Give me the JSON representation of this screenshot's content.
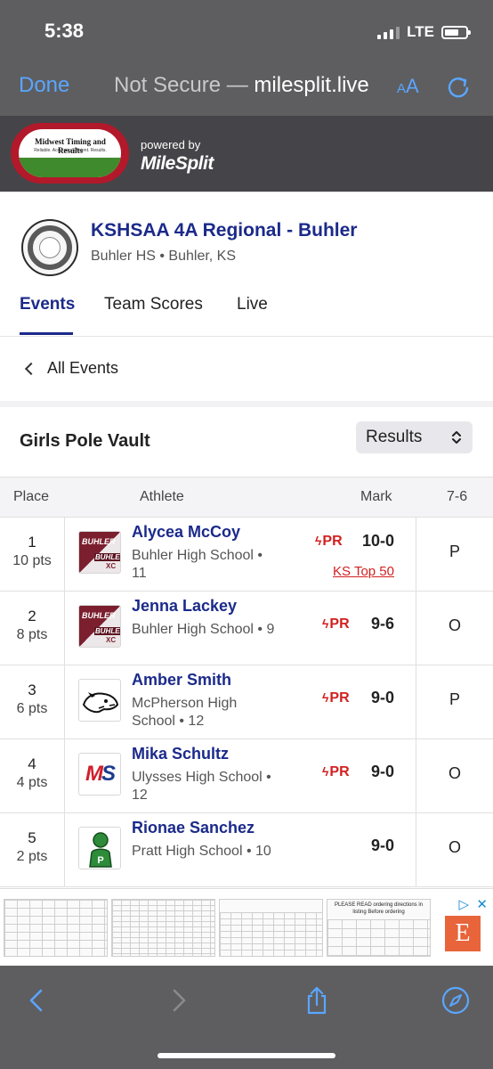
{
  "status": {
    "time": "5:38",
    "network": "LTE"
  },
  "browser": {
    "done": "Done",
    "not_secure": "Not Secure —",
    "host": "milesplit.live",
    "aa_small": "A",
    "aa_large": "A"
  },
  "banner": {
    "logo_title": "Midwest Timing and Results",
    "logo_tagline": "Reliable. Accurate. Efficient. Results.",
    "powered_by": "powered by",
    "brand": "MileSplit"
  },
  "meet": {
    "title": "KSHSAA 4A Regional - Buhler",
    "location": "Buhler HS • Buhler, KS"
  },
  "tabs": [
    {
      "label": "Events",
      "active": true
    },
    {
      "label": "Team Scores",
      "active": false
    },
    {
      "label": "Live",
      "active": false
    }
  ],
  "back": {
    "label": "All Events"
  },
  "event": {
    "name": "Girls Pole Vault",
    "view_select": "Results"
  },
  "table": {
    "headers": {
      "place": "Place",
      "athlete": "Athlete",
      "mark": "Mark",
      "height": "7-6"
    },
    "rows": [
      {
        "place": "1",
        "pts": "10 pts",
        "name": "Alycea McCoy",
        "school": "Buhler High School • 11",
        "pr": "PR",
        "mark": "10-0",
        "note": "KS Top 50",
        "attempt": "P",
        "logo": "buhler-crusaders-logo"
      },
      {
        "place": "2",
        "pts": "8 pts",
        "name": "Jenna Lackey",
        "school": "Buhler High School • 9",
        "pr": "PR",
        "mark": "9-6",
        "attempt": "O",
        "logo": "buhler-crusaders-logo"
      },
      {
        "place": "3",
        "pts": "6 pts",
        "name": "Amber Smith",
        "school": "McPherson High School • 12",
        "pr": "PR",
        "mark": "9-0",
        "attempt": "P",
        "logo": "mcpherson-bulldog-logo"
      },
      {
        "place": "4",
        "pts": "4 pts",
        "name": "Mika Schultz",
        "school": "Ulysses High School • 12",
        "pr": "PR",
        "mark": "9-0",
        "attempt": "O",
        "logo": "ulysses-ms-logo"
      },
      {
        "place": "5",
        "pts": "2 pts",
        "name": "Rionae Sanchez",
        "school": "Pratt High School • 10",
        "pr": "",
        "mark": "9-0",
        "attempt": "O",
        "logo": "pratt-greenback-logo"
      }
    ]
  },
  "ad": {
    "etsy_letter": "E",
    "thumb4_text": "PLEASE READ ordering directions in listing Before ordering"
  },
  "colors": {
    "brand_navy": "#1b2a8a",
    "pr_red": "#d32020",
    "ios_blue": "#5aa6ff",
    "chrome_gray": "#5e5e60"
  }
}
